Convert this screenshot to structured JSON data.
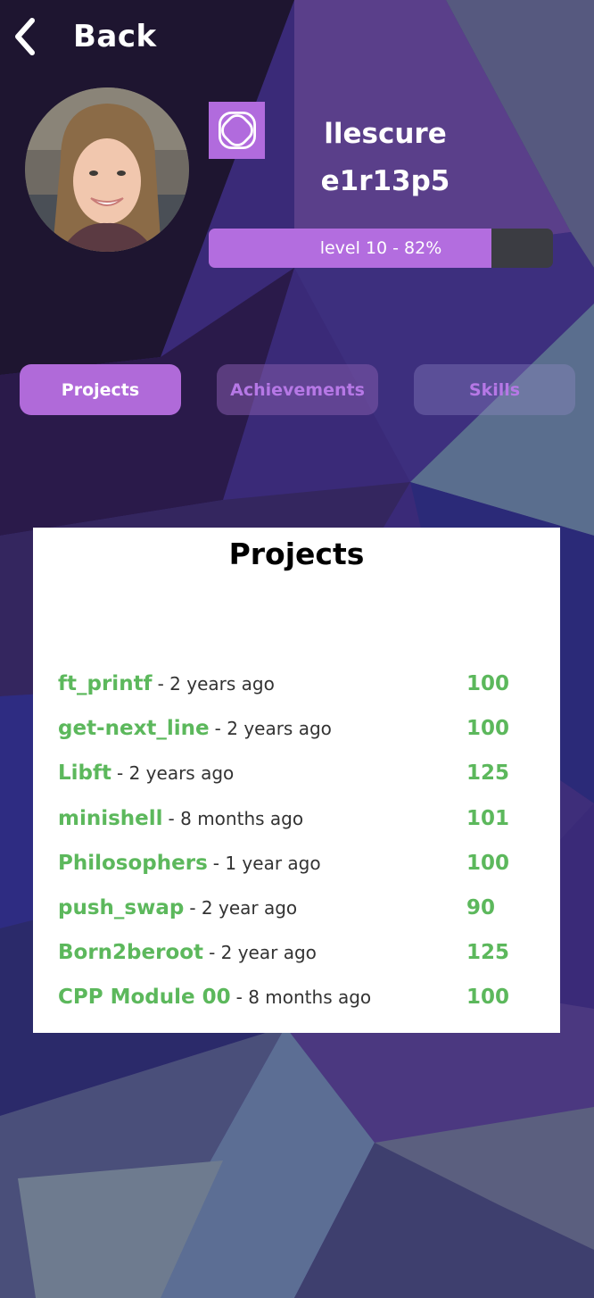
{
  "header": {
    "back_label": "Back"
  },
  "profile": {
    "login": "llescure",
    "coalition_code": "e1r13p5",
    "level_text": "level 10 - 82%",
    "level_progress": 0.82
  },
  "tabs": [
    {
      "label": "Projects",
      "active": true
    },
    {
      "label": "Achievements",
      "active": false
    },
    {
      "label": "Skills",
      "active": false
    }
  ],
  "projects": {
    "title": "Projects",
    "items": [
      {
        "name": "ft_printf",
        "date": "- 2 years ago",
        "score": "100"
      },
      {
        "name": "get-next_line",
        "date": "- 2 years ago",
        "score": "100"
      },
      {
        "name": "Libft",
        "date": "- 2 years ago",
        "score": "125"
      },
      {
        "name": "minishell",
        "date": "- 8 months ago",
        "score": "101"
      },
      {
        "name": "Philosophers",
        "date": "- 1 year ago",
        "score": "100"
      },
      {
        "name": "push_swap",
        "date": "- 2 year ago",
        "score": "90"
      },
      {
        "name": "Born2beroot",
        "date": "- 2 year ago",
        "score": "125"
      },
      {
        "name": "CPP Module 00",
        "date": "- 8 months ago",
        "score": "100"
      }
    ]
  },
  "colors": {
    "accent": "#b06ad9",
    "project_green": "#5cb85c",
    "level_track": "#3b3c42"
  }
}
